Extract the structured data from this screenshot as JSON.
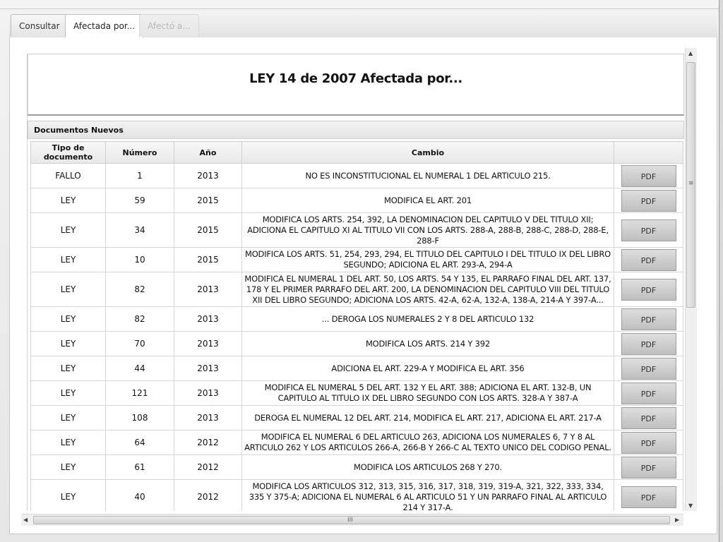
{
  "tabs": [
    {
      "label": "Consultar",
      "state": "normal"
    },
    {
      "label": "Afectada por...",
      "state": "active"
    },
    {
      "label": "Afectó a...",
      "state": "disabled"
    }
  ],
  "report": {
    "title": "LEY 14 de 2007 Afectada por...",
    "section_title": "Documentos Nuevos"
  },
  "table": {
    "headers": {
      "tipo": "Tipo de documento",
      "numero": "Número",
      "anio": "Año",
      "cambio": "Cambio",
      "action": ""
    },
    "rows": [
      {
        "tipo": "FALLO",
        "numero": "1",
        "anio": "2013",
        "cambio": "NO ES INCONSTITUCIONAL EL NUMERAL 1 DEL ARTICULO 215.",
        "action": "PDF"
      },
      {
        "tipo": "LEY",
        "numero": "59",
        "anio": "2015",
        "cambio": "MODIFICA EL ART. 201",
        "action": "PDF"
      },
      {
        "tipo": "LEY",
        "numero": "34",
        "anio": "2015",
        "cambio": "MODIFICA LOS ARTS. 254, 392, LA DENOMINACION DEL CAPITULO V DEL TITULO XII; ADICIONA EL CAPITULO XI AL TITULO VII CON LOS ARTS. 288-A, 288-B, 288-C, 288-D, 288-E, 288-F",
        "action": "PDF"
      },
      {
        "tipo": "LEY",
        "numero": "10",
        "anio": "2015",
        "cambio": "MODIFICA LOS ARTS. 51, 254, 293, 294, EL TITULO DEL CAPITULO I DEL TITULO IX DEL LIBRO SEGUNDO; ADICIONA EL ART. 293-A, 294-A",
        "action": "PDF"
      },
      {
        "tipo": "LEY",
        "numero": "82",
        "anio": "2013",
        "cambio": "MODIFICA EL NUMERAL 1 DEL ART. 50, LOS ARTS. 54 Y 135, EL PARRAFO FINAL DEL ART. 137, 178 Y EL PRIMER PARRAFO DEL ART. 200, LA DENOMINACION DEL CAPITULO VIII DEL TITULO XII DEL LIBRO SEGUNDO; ADICIONA LOS ARTS. 42-A, 62-A, 132-A, 138-A, 214-A Y 397-A...",
        "action": "PDF"
      },
      {
        "tipo": "LEY",
        "numero": "82",
        "anio": "2013",
        "cambio": "... DEROGA LOS NUMERALES 2 Y 8 DEL ARTICULO 132",
        "action": "PDF"
      },
      {
        "tipo": "LEY",
        "numero": "70",
        "anio": "2013",
        "cambio": "MODIFICA LOS ARTS. 214 Y 392",
        "action": "PDF"
      },
      {
        "tipo": "LEY",
        "numero": "44",
        "anio": "2013",
        "cambio": "ADICIONA EL ART. 229-A Y MODIFICA EL ART. 356",
        "action": "PDF"
      },
      {
        "tipo": "LEY",
        "numero": "121",
        "anio": "2013",
        "cambio": "MODIFICA EL NUMERAL 5 DEL ART. 132 Y EL ART. 388; ADICIONA EL ART. 132-B, UN CAPITULO AL TITULO IX DEL LIBRO SEGUNDO CON LOS ARTS. 328-A Y 387-A",
        "action": "PDF"
      },
      {
        "tipo": "LEY",
        "numero": "108",
        "anio": "2013",
        "cambio": "DEROGA EL NUMERAL 12 DEL ART. 214, MODIFICA EL ART. 217, ADICIONA EL ART. 217-A",
        "action": "PDF"
      },
      {
        "tipo": "LEY",
        "numero": "64",
        "anio": "2012",
        "cambio": "MODIFICA EL NUMERAL 6 DEL ARTICULO 263, ADICIONA LOS NUMERALES 6, 7 Y 8 AL ARTICULO 262 Y LOS ARTICULOS 266-A, 266-B Y 266-C AL TEXTO UNICO DEL CODIGO PENAL.",
        "action": "PDF"
      },
      {
        "tipo": "LEY",
        "numero": "61",
        "anio": "2012",
        "cambio": "MODIFICA LOS ARTICULOS 268 Y 270.",
        "action": "PDF"
      },
      {
        "tipo": "LEY",
        "numero": "40",
        "anio": "2012",
        "cambio": "MODIFICA LOS ARTICULOS 312, 313, 315, 316, 317, 318, 319, 319-A, 321, 322, 333, 334, 335 Y 375-A; ADICIONA EL NUMERAL 6 AL ARTICULO 51 Y UN PARRAFO FINAL AL ARTICULO 214 Y 317-A.",
        "action": "PDF"
      }
    ]
  },
  "scrollbars": {
    "up_arrow": "▲",
    "down_arrow": "▼",
    "left_arrow": "◀",
    "right_arrow": "▶",
    "v_grip": "≡",
    "h_grip": "III"
  }
}
